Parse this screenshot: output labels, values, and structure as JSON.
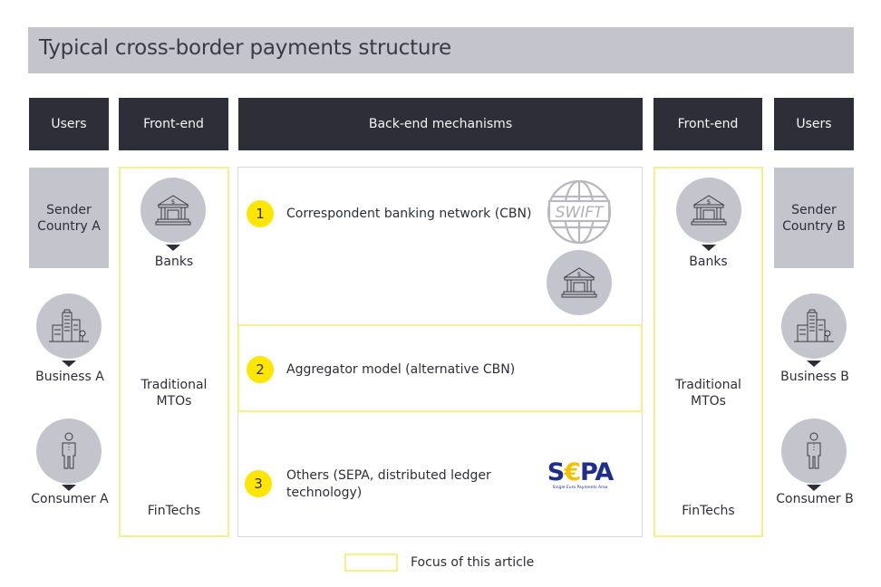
{
  "title": "Typical cross-border payments structure",
  "headers": {
    "users_left": "Users",
    "frontend_left": "Front-end",
    "backend": "Back-end mechanisms",
    "frontend_right": "Front-end",
    "users_right": "Users"
  },
  "left_users": {
    "country": "Sender\nCountry A",
    "country_line1": "Sender",
    "country_line2": "Country A",
    "business": {
      "label": "Business A",
      "icon": "office-buildings-icon"
    },
    "consumer": {
      "label": "Consumer A",
      "icon": "person-icon"
    }
  },
  "right_users": {
    "country_line1": "Sender",
    "country_line2": "Country B",
    "business": {
      "label": "Business B",
      "icon": "office-buildings-icon"
    },
    "consumer": {
      "label": "Consumer B",
      "icon": "person-icon"
    }
  },
  "frontend": {
    "banks": {
      "label": "Banks",
      "icon": "bank-icon"
    },
    "mtos_line1": "Traditional",
    "mtos_line2": "MTOs",
    "fintechs": "FinTechs"
  },
  "mechanisms": [
    {
      "number": "1",
      "label": "Correspondent banking network (CBN)",
      "logos": [
        "swift-globe-logo",
        "bank-icon"
      ]
    },
    {
      "number": "2",
      "label": "Aggregator model (alternative CBN)"
    },
    {
      "number": "3",
      "label_line1": "Others (SEPA, distributed ledger",
      "label_line2": "technology)",
      "logos": [
        "sepa-logo"
      ]
    }
  ],
  "logos": {
    "swift": "SWIFT",
    "sepa_s": "S",
    "sepa_euro": "€",
    "sepa_pa": "PA",
    "sepa_tagline": "Single Euro Payments Area"
  },
  "legend": {
    "label": "Focus of this article"
  },
  "colors": {
    "header_dark": "#2e2e38",
    "country_gray": "#c4c4cd",
    "focus_yellow": "#f4f18a",
    "number_yellow": "#ffe600",
    "sepa_blue": "#1f2e8a"
  }
}
